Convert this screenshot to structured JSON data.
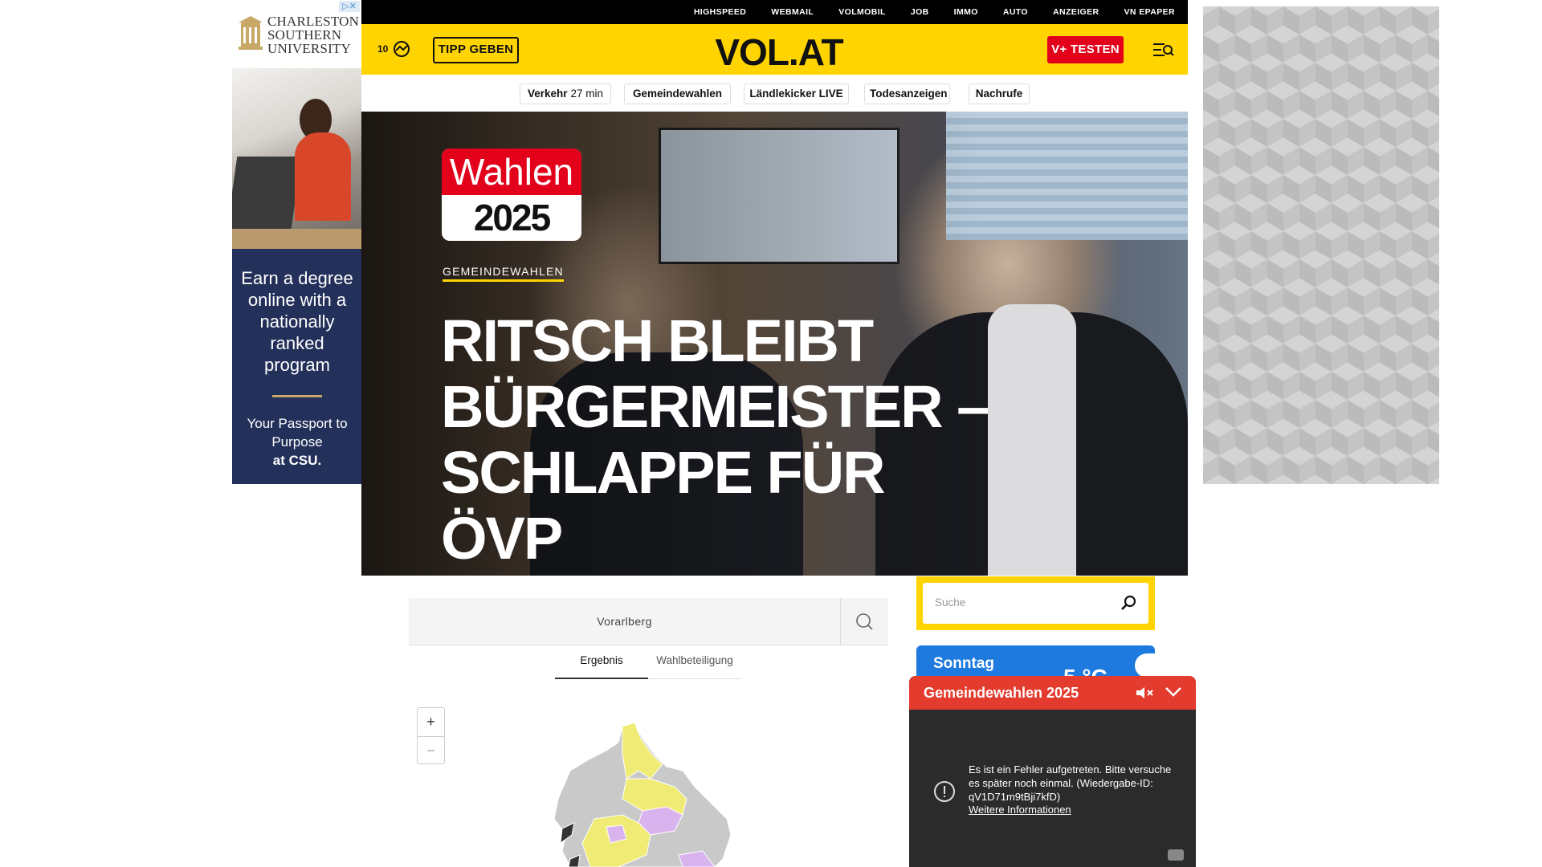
{
  "ad_left": {
    "brand": "CHARLESTON SOUTHERN UNIVERSITY",
    "brand_line1": "CHARLESTON",
    "brand_line2": "SOUTHERN",
    "brand_line3": "UNIVERSITY",
    "headline": "Earn a degree online with a nationally ranked program",
    "tagline_1": "Your Passport to Purpose",
    "tagline_2": "at CSU.",
    "adchoices": "▷✕"
  },
  "topnav": [
    "HIGHSPEED",
    "WEBMAIL",
    "VOLMOBIL",
    "JOB",
    "IMMO",
    "AUTO",
    "ANZEIGER",
    "VN EPAPER"
  ],
  "header": {
    "temperature": "10",
    "tipp_label": "TIPP GEBEN",
    "logo": "VOL.AT",
    "vplus_label": "V+ TESTEN"
  },
  "subnav": {
    "traffic_label": "Verkehr",
    "traffic_time": "27 min",
    "items": [
      "Gemeindewahlen",
      "Ländlekicker LIVE",
      "Todesanzeigen",
      "Nachrufe"
    ]
  },
  "hero": {
    "badge_top": "Wahlen",
    "badge_year": "2025",
    "kicker": "GEMEINDEWAHLEN",
    "headline": "RITSCH BLEIBT BÜRGERMEISTER – SCHLAPPE FÜR ÖVP"
  },
  "map_widget": {
    "search_value": "Vorarlberg",
    "tabs": [
      "Ergebnis",
      "Wahlbeteiligung"
    ],
    "active_tab": "Ergebnis",
    "zoom_in": "+",
    "zoom_out": "−",
    "colors": {
      "gray": "#c9c9c9",
      "yellow": "#efeb74",
      "purple": "#d9b3ee",
      "dark": "#333333"
    }
  },
  "sidebar": {
    "search_placeholder": "Suche",
    "weather_day": "Sonntag",
    "weather_temp": "5 °C"
  },
  "player": {
    "title": "Gemeindewahlen 2025",
    "error_text": "Es ist ein Fehler aufgetreten. Bitte versuche es später noch einmal. (Wiedergabe-ID: qV1D71m9tBji7kfD)",
    "more_link": "Weitere Informationen"
  },
  "colors": {
    "brand_yellow": "#ffd400",
    "brand_red": "#e2001a",
    "player_red": "#e33b2e",
    "weather_blue": "#1f7ae0"
  }
}
